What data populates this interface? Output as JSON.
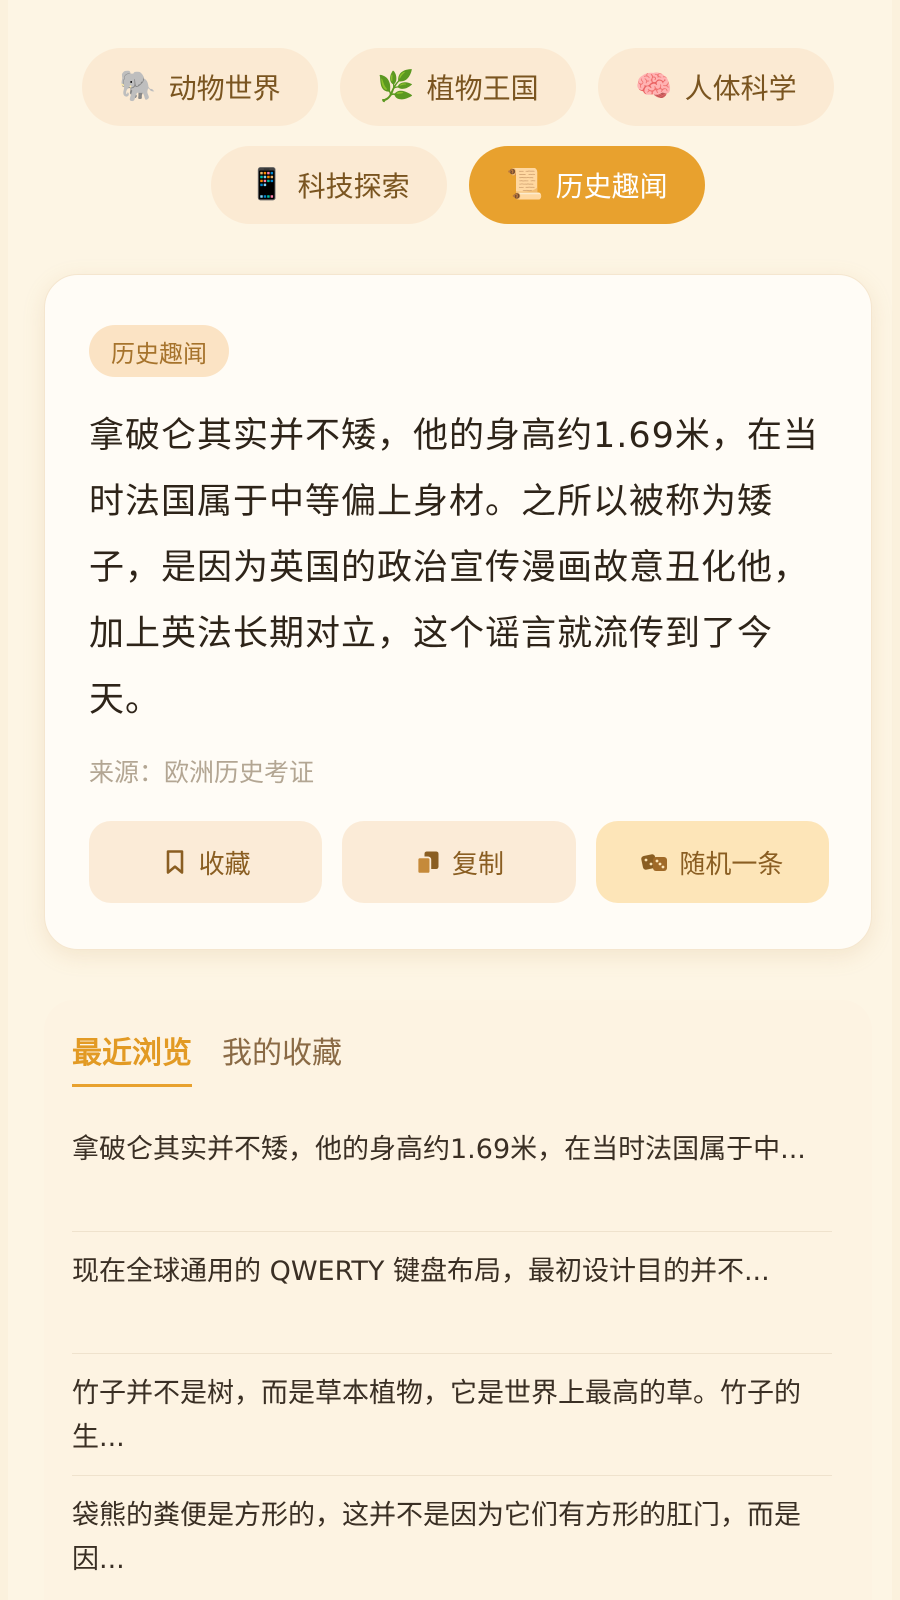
{
  "categories": [
    {
      "emoji": "🐘",
      "label": "动物世界",
      "active": false
    },
    {
      "emoji": "🌿",
      "label": "植物王国",
      "active": false
    },
    {
      "emoji": "🧠",
      "label": "人体科学",
      "active": false
    },
    {
      "emoji": "📱",
      "label": "科技探索",
      "active": false
    },
    {
      "emoji": "📜",
      "label": "历史趣闻",
      "active": true
    }
  ],
  "card": {
    "tag": "历史趣闻",
    "text": "拿破仑其实并不矮，他的身高约1.69米，在当时法国属于中等偏上身材。之所以被称为矮子，是因为英国的政治宣传漫画故意丑化他，加上英法长期对立，这个谣言就流传到了今天。",
    "source": "来源：欧洲历史考证",
    "actions": {
      "favorite": "收藏",
      "copy": "复制",
      "random": "随机一条"
    }
  },
  "panel": {
    "tabs": [
      "最近浏览",
      "我的收藏"
    ],
    "items": [
      "拿破仑其实并不矮，他的身高约1.69米，在当时法国属于中...",
      "现在全球通用的 QWERTY 键盘布局，最初设计目的并不...",
      "竹子并不是树，而是草本植物，它是世界上最高的草。竹子的生...",
      "袋熊的粪便是方形的，这并不是因为它们有方形的肛门，而是因..."
    ]
  },
  "colors": {
    "accent": "#e8a12e",
    "chip_bg": "#fbead3",
    "background": "#fdf5e4"
  }
}
